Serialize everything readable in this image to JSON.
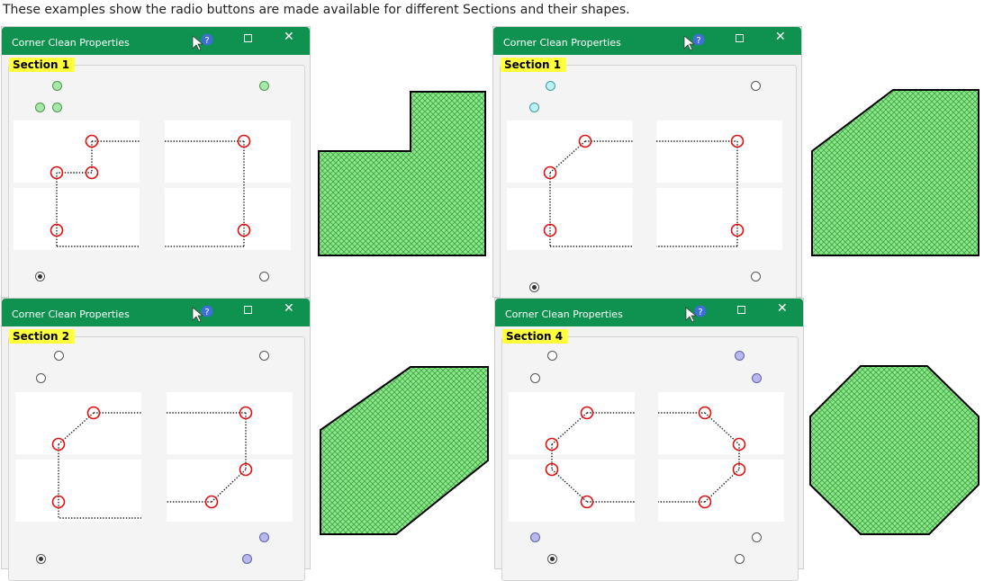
{
  "caption": "These examples show the radio buttons are made available for different Sections and their shapes.",
  "colors": {
    "titlebar": "#0f9150",
    "section_highlight": "#ffff3b",
    "corner_marker": "#e01010",
    "shape_fill": "#7ee07e"
  },
  "dialogs": [
    {
      "title": "Corner Clean Properties",
      "section": "Section 1",
      "help_icon": "help-pointer-icon",
      "max_icon": "maximize-icon",
      "close_icon": "close-icon",
      "close_glyph": "✕"
    },
    {
      "title": "Corner Clean Properties",
      "section": "Section 1",
      "help_icon": "help-pointer-icon",
      "max_icon": "maximize-icon",
      "close_icon": "close-icon",
      "close_glyph": "✕"
    },
    {
      "title": "Corner Clean Properties",
      "section": "Section 2",
      "help_icon": "help-pointer-icon",
      "max_icon": "maximize-icon",
      "close_icon": "close-icon",
      "close_glyph": "✕"
    },
    {
      "title": "Corner Clean Properties",
      "section": "Section 4",
      "help_icon": "help-pointer-icon",
      "max_icon": "maximize-icon",
      "close_icon": "close-icon",
      "close_glyph": "✕"
    }
  ]
}
